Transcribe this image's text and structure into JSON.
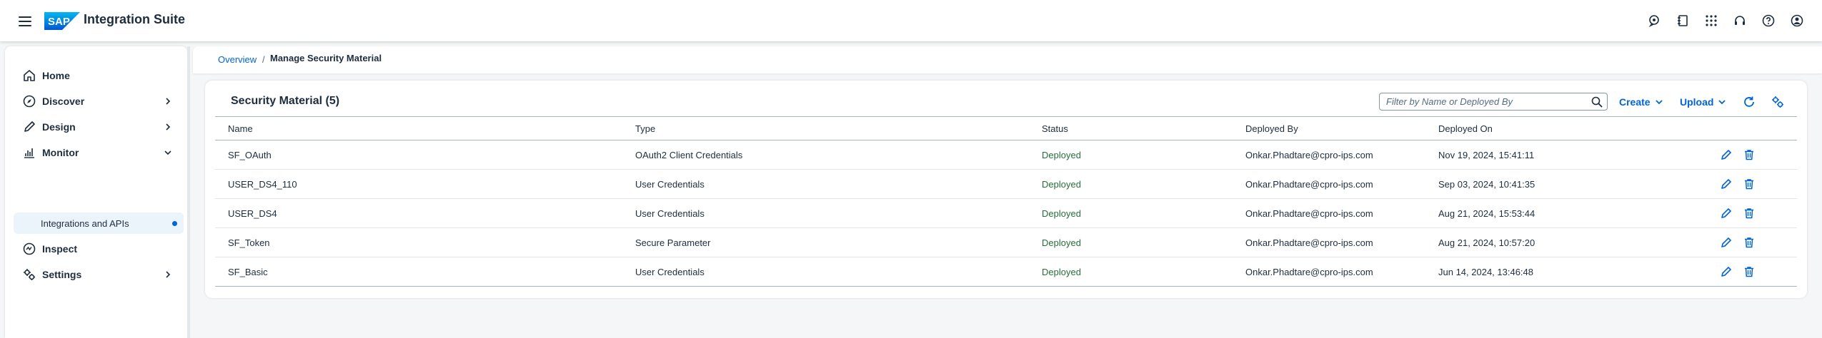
{
  "app": {
    "product_name": "Integration Suite",
    "brand_label": "SAP",
    "brand_color": "#0070f2",
    "accent_color": "#0064d9",
    "shell_actions": [
      "headset-chat-icon",
      "notebook-icon",
      "apps-grid-icon",
      "support-headset-icon",
      "help-icon",
      "user-profile-icon"
    ]
  },
  "sidebar": {
    "items": [
      {
        "label": "Home",
        "icon": "home-icon"
      },
      {
        "label": "Discover",
        "icon": "compass-icon"
      },
      {
        "label": "Design",
        "icon": "pencil-icon"
      },
      {
        "label": "Monitor",
        "icon": "bar-chart-icon"
      },
      {
        "label": "Inspect",
        "icon": "inspect-icon"
      },
      {
        "label": "Settings",
        "icon": "settings-icon"
      }
    ],
    "sub_items": [
      {
        "label": "Integrations and APIs",
        "selected": true
      }
    ]
  },
  "breadcrumb": {
    "link": "Overview",
    "separator": "/",
    "current": "Manage Security Material"
  },
  "panel": {
    "title": "Security Material (5)",
    "search_placeholder": "Filter by Name or Deployed By",
    "create_label": "Create",
    "upload_label": "Upload"
  },
  "table": {
    "columns": [
      "Name",
      "Type",
      "Status",
      "Deployed By",
      "Deployed On"
    ],
    "rows": [
      {
        "name": "SF_OAuth",
        "type": "OAuth2 Client Credentials",
        "status": "Deployed",
        "deployed_by": "Onkar.Phadtare@cpro-ips.com",
        "deployed_on": "Nov 19, 2024, 15:41:11"
      },
      {
        "name": "USER_DS4_110",
        "type": "User Credentials",
        "status": "Deployed",
        "deployed_by": "Onkar.Phadtare@cpro-ips.com",
        "deployed_on": "Sep 03, 2024, 10:41:35"
      },
      {
        "name": "USER_DS4",
        "type": "User Credentials",
        "status": "Deployed",
        "deployed_by": "Onkar.Phadtare@cpro-ips.com",
        "deployed_on": "Aug 21, 2024, 15:53:44"
      },
      {
        "name": "SF_Token",
        "type": "Secure Parameter",
        "status": "Deployed",
        "deployed_by": "Onkar.Phadtare@cpro-ips.com",
        "deployed_on": "Aug 21, 2024, 10:57:20"
      },
      {
        "name": "SF_Basic",
        "type": "User Credentials",
        "status": "Deployed",
        "deployed_by": "Onkar.Phadtare@cpro-ips.com",
        "deployed_on": "Jun 14, 2024, 13:46:48"
      }
    ],
    "status_color": "#256f3a"
  }
}
